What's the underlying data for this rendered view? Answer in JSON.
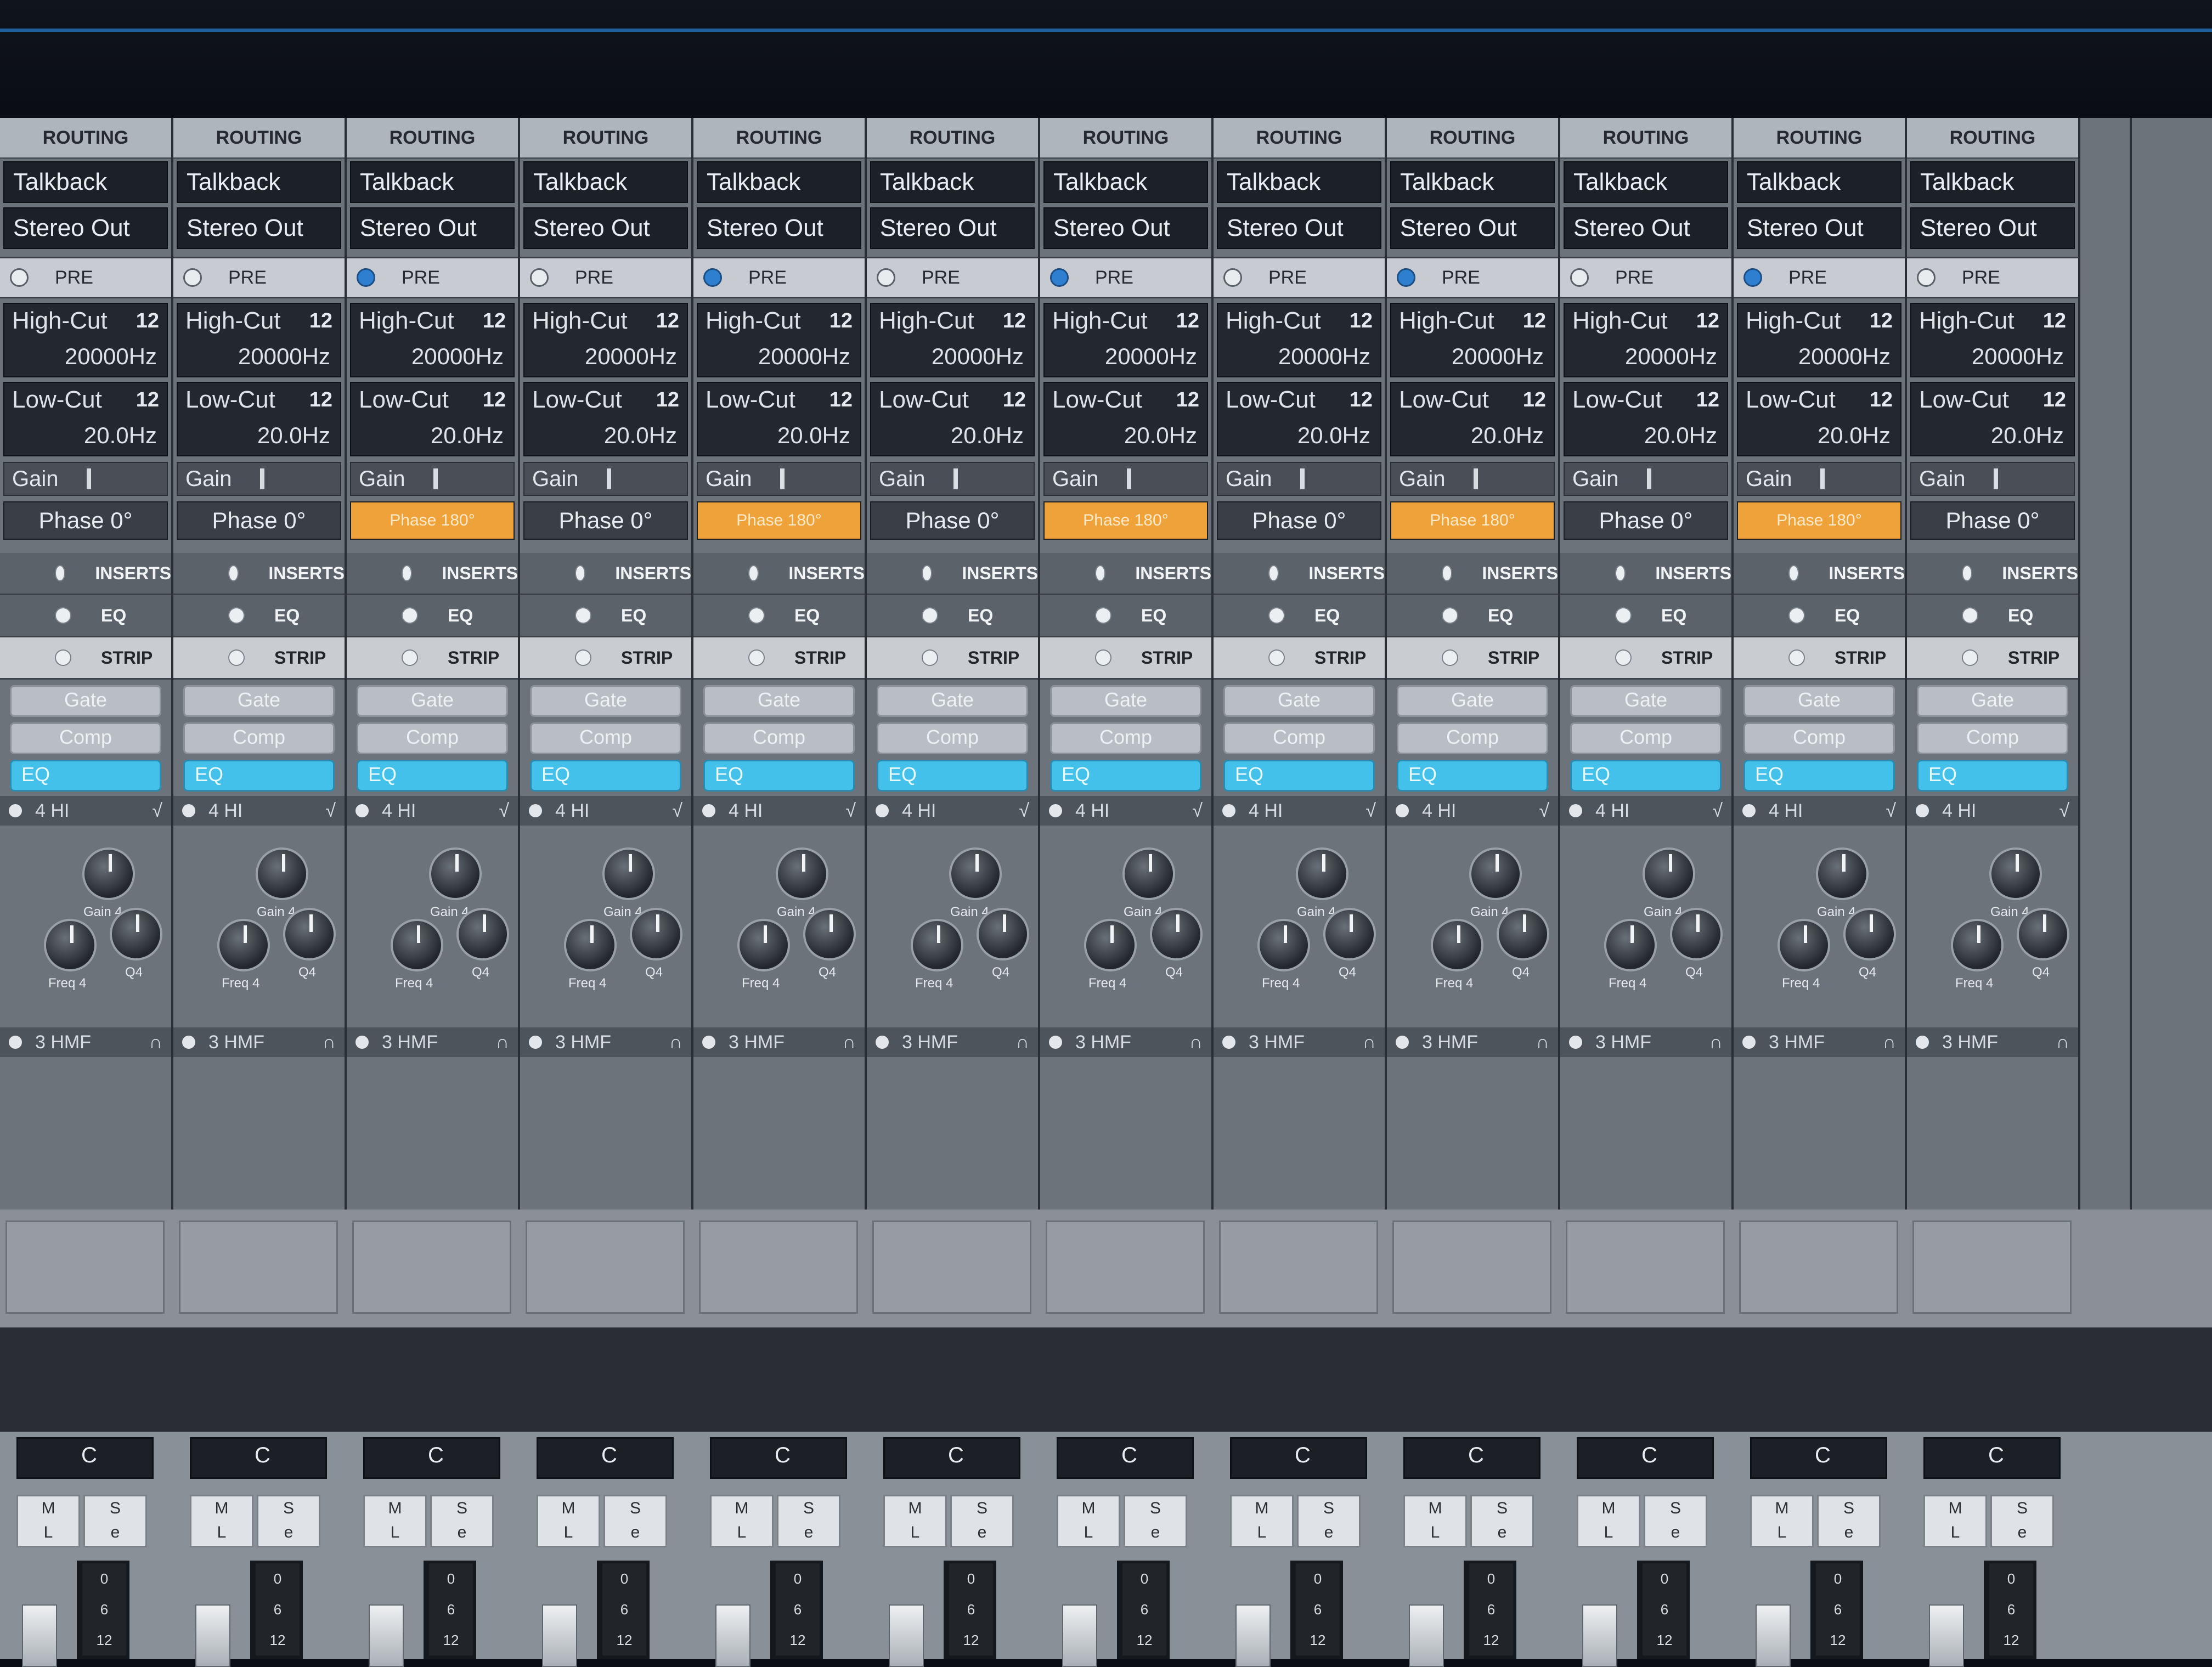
{
  "channels": [
    {
      "routing": "ROUTING",
      "input": "Talkback",
      "output": "Stereo Out",
      "pre": "PRE",
      "pre_on": false,
      "highcut_label": "High-Cut",
      "highcut_value": "20000Hz",
      "lowcut_label": "Low-Cut",
      "lowcut_value": "20.0Hz",
      "gain": "Gain",
      "phase": "Phase 0°",
      "phase_active": false,
      "inserts": "INSERTS",
      "eq": "EQ",
      "strip": "STRIP",
      "gate": "Gate",
      "comp": "Comp",
      "eq_mod": "EQ",
      "band4": "4 HI",
      "gain4": "Gain 4",
      "freq4": "Freq 4",
      "q4": "Q4",
      "band3": "3 HMF",
      "pan": "C",
      "mute": "M",
      "solo": "S",
      "listen": "L",
      "edit": "e"
    },
    {
      "routing": "ROUTING",
      "input": "Talkback",
      "output": "Stereo Out",
      "pre": "PRE",
      "pre_on": false,
      "highcut_label": "High-Cut",
      "highcut_value": "20000Hz",
      "lowcut_label": "Low-Cut",
      "lowcut_value": "20.0Hz",
      "gain": "Gain",
      "phase": "Phase 0°",
      "phase_active": false,
      "inserts": "INSERTS",
      "eq": "EQ",
      "strip": "STRIP",
      "gate": "Gate",
      "comp": "Comp",
      "eq_mod": "EQ",
      "band4": "4 HI",
      "gain4": "Gain 4",
      "freq4": "Freq 4",
      "q4": "Q4",
      "band3": "3 HMF",
      "pan": "C",
      "mute": "M",
      "solo": "S",
      "listen": "L",
      "edit": "e"
    },
    {
      "routing": "ROUTING",
      "input": "Talkback",
      "output": "Stereo Out",
      "pre": "PRE",
      "pre_on": true,
      "highcut_label": "High-Cut",
      "highcut_value": "20000Hz",
      "lowcut_label": "Low-Cut",
      "lowcut_value": "20.0Hz",
      "gain": "Gain",
      "phase": "Phase 180°",
      "phase_active": true,
      "inserts": "INSERTS",
      "eq": "EQ",
      "strip": "STRIP",
      "gate": "Gate",
      "comp": "Comp",
      "eq_mod": "EQ",
      "band4": "4 HI",
      "gain4": "Gain 4",
      "freq4": "Freq 4",
      "q4": "Q4",
      "band3": "3 HMF",
      "pan": "C",
      "mute": "M",
      "solo": "S",
      "listen": "L",
      "edit": "e"
    },
    {
      "routing": "ROUTING",
      "input": "Talkback",
      "output": "Stereo Out",
      "pre": "PRE",
      "pre_on": false,
      "highcut_label": "High-Cut",
      "highcut_value": "20000Hz",
      "lowcut_label": "Low-Cut",
      "lowcut_value": "20.0Hz",
      "gain": "Gain",
      "phase": "Phase 0°",
      "phase_active": false,
      "inserts": "INSERTS",
      "eq": "EQ",
      "strip": "STRIP",
      "gate": "Gate",
      "comp": "Comp",
      "eq_mod": "EQ",
      "band4": "4 HI",
      "gain4": "Gain 4",
      "freq4": "Freq 4",
      "q4": "Q4",
      "band3": "3 HMF",
      "pan": "C",
      "mute": "M",
      "solo": "S",
      "listen": "L",
      "edit": "e"
    },
    {
      "routing": "ROUTING",
      "input": "Talkback",
      "output": "Stereo Out",
      "pre": "PRE",
      "pre_on": true,
      "highcut_label": "High-Cut",
      "highcut_value": "20000Hz",
      "lowcut_label": "Low-Cut",
      "lowcut_value": "20.0Hz",
      "gain": "Gain",
      "phase": "Phase 180°",
      "phase_active": true,
      "inserts": "INSERTS",
      "eq": "EQ",
      "strip": "STRIP",
      "gate": "Gate",
      "comp": "Comp",
      "eq_mod": "EQ",
      "band4": "4 HI",
      "gain4": "Gain 4",
      "freq4": "Freq 4",
      "q4": "Q4",
      "band3": "3 HMF",
      "pan": "C",
      "mute": "M",
      "solo": "S",
      "listen": "L",
      "edit": "e"
    },
    {
      "routing": "ROUTING",
      "input": "Talkback",
      "output": "Stereo Out",
      "pre": "PRE",
      "pre_on": false,
      "highcut_label": "High-Cut",
      "highcut_value": "20000Hz",
      "lowcut_label": "Low-Cut",
      "lowcut_value": "20.0Hz",
      "gain": "Gain",
      "phase": "Phase 0°",
      "phase_active": false,
      "inserts": "INSERTS",
      "eq": "EQ",
      "strip": "STRIP",
      "gate": "Gate",
      "comp": "Comp",
      "eq_mod": "EQ",
      "band4": "4 HI",
      "gain4": "Gain 4",
      "freq4": "Freq 4",
      "q4": "Q4",
      "band3": "3 HMF",
      "pan": "C",
      "mute": "M",
      "solo": "S",
      "listen": "L",
      "edit": "e"
    },
    {
      "routing": "ROUTING",
      "input": "Talkback",
      "output": "Stereo Out",
      "pre": "PRE",
      "pre_on": true,
      "highcut_label": "High-Cut",
      "highcut_value": "20000Hz",
      "lowcut_label": "Low-Cut",
      "lowcut_value": "20.0Hz",
      "gain": "Gain",
      "phase": "Phase 180°",
      "phase_active": true,
      "inserts": "INSERTS",
      "eq": "EQ",
      "strip": "STRIP",
      "gate": "Gate",
      "comp": "Comp",
      "eq_mod": "EQ",
      "band4": "4 HI",
      "gain4": "Gain 4",
      "freq4": "Freq 4",
      "q4": "Q4",
      "band3": "3 HMF",
      "pan": "C",
      "mute": "M",
      "solo": "S",
      "listen": "L",
      "edit": "e"
    },
    {
      "routing": "ROUTING",
      "input": "Talkback",
      "output": "Stereo Out",
      "pre": "PRE",
      "pre_on": false,
      "highcut_label": "High-Cut",
      "highcut_value": "20000Hz",
      "lowcut_label": "Low-Cut",
      "lowcut_value": "20.0Hz",
      "gain": "Gain",
      "phase": "Phase 0°",
      "phase_active": false,
      "inserts": "INSERTS",
      "eq": "EQ",
      "strip": "STRIP",
      "gate": "Gate",
      "comp": "Comp",
      "eq_mod": "EQ",
      "band4": "4 HI",
      "gain4": "Gain 4",
      "freq4": "Freq 4",
      "q4": "Q4",
      "band3": "3 HMF",
      "pan": "C",
      "mute": "M",
      "solo": "S",
      "listen": "L",
      "edit": "e"
    },
    {
      "routing": "ROUTING",
      "input": "Talkback",
      "output": "Stereo Out",
      "pre": "PRE",
      "pre_on": true,
      "highcut_label": "High-Cut",
      "highcut_value": "20000Hz",
      "lowcut_label": "Low-Cut",
      "lowcut_value": "20.0Hz",
      "gain": "Gain",
      "phase": "Phase 180°",
      "phase_active": true,
      "inserts": "INSERTS",
      "eq": "EQ",
      "strip": "STRIP",
      "gate": "Gate",
      "comp": "Comp",
      "eq_mod": "EQ",
      "band4": "4 HI",
      "gain4": "Gain 4",
      "freq4": "Freq 4",
      "q4": "Q4",
      "band3": "3 HMF",
      "pan": "C",
      "mute": "M",
      "solo": "S",
      "listen": "L",
      "edit": "e"
    },
    {
      "routing": "ROUTING",
      "input": "Talkback",
      "output": "Stereo Out",
      "pre": "PRE",
      "pre_on": false,
      "highcut_label": "High-Cut",
      "highcut_value": "20000Hz",
      "lowcut_label": "Low-Cut",
      "lowcut_value": "20.0Hz",
      "gain": "Gain",
      "phase": "Phase 0°",
      "phase_active": false,
      "inserts": "INSERTS",
      "eq": "EQ",
      "strip": "STRIP",
      "gate": "Gate",
      "comp": "Comp",
      "eq_mod": "EQ",
      "band4": "4 HI",
      "gain4": "Gain 4",
      "freq4": "Freq 4",
      "q4": "Q4",
      "band3": "3 HMF",
      "pan": "C",
      "mute": "M",
      "solo": "S",
      "listen": "L",
      "edit": "e"
    },
    {
      "routing": "ROUTING",
      "input": "Talkback",
      "output": "Stereo Out",
      "pre": "PRE",
      "pre_on": true,
      "highcut_label": "High-Cut",
      "highcut_value": "20000Hz",
      "lowcut_label": "Low-Cut",
      "lowcut_value": "20.0Hz",
      "gain": "Gain",
      "phase": "Phase 180°",
      "phase_active": true,
      "inserts": "INSERTS",
      "eq": "EQ",
      "strip": "STRIP",
      "gate": "Gate",
      "comp": "Comp",
      "eq_mod": "EQ",
      "band4": "4 HI",
      "gain4": "Gain 4",
      "freq4": "Freq 4",
      "q4": "Q4",
      "band3": "3 HMF",
      "pan": "C",
      "mute": "M",
      "solo": "S",
      "listen": "L",
      "edit": "e"
    },
    {
      "routing": "ROUTING",
      "input": "Talkback",
      "output": "Stereo Out",
      "pre": "PRE",
      "pre_on": false,
      "highcut_label": "High-Cut",
      "highcut_value": "20000Hz",
      "lowcut_label": "Low-Cut",
      "lowcut_value": "20.0Hz",
      "gain": "Gain",
      "phase": "Phase 0°",
      "phase_active": false,
      "inserts": "INSERTS",
      "eq": "EQ",
      "strip": "STRIP",
      "gate": "Gate",
      "comp": "Comp",
      "eq_mod": "EQ",
      "band4": "4 HI",
      "gain4": "Gain 4",
      "freq4": "Freq 4",
      "q4": "Q4",
      "band3": "3 HMF",
      "pan": "C",
      "mute": "M",
      "solo": "S",
      "listen": "L",
      "edit": "e"
    }
  ],
  "slope_badge": "12",
  "fader_scale": [
    "0",
    "6",
    "12"
  ]
}
